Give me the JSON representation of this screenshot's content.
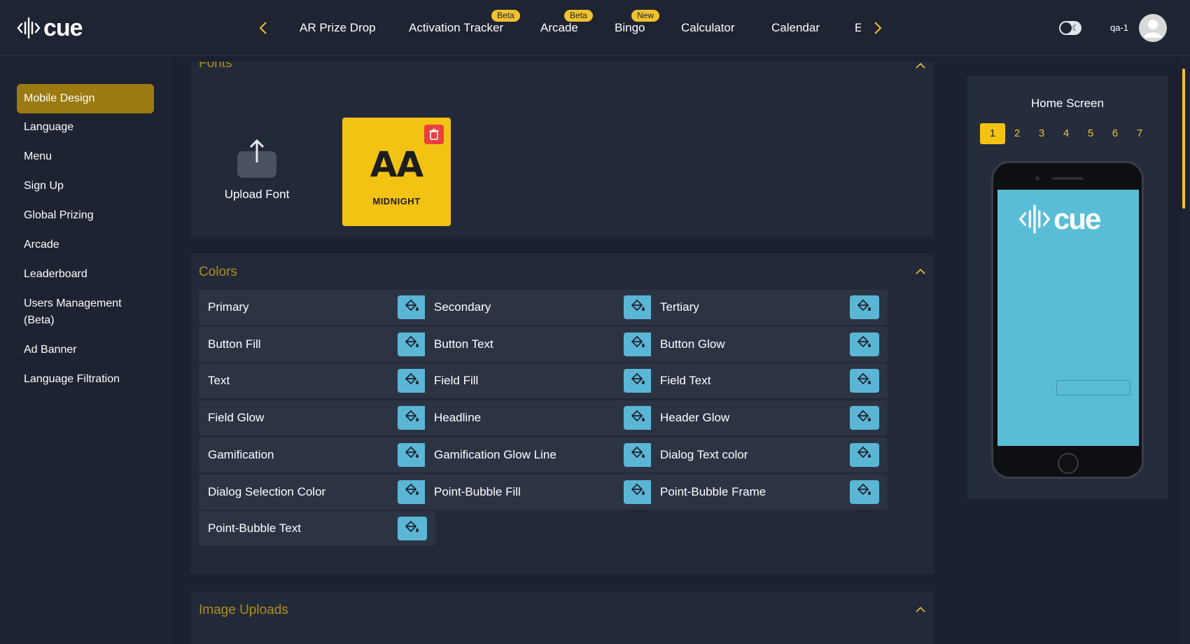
{
  "app": {
    "logo_text": "cue",
    "user_name": "qa-1"
  },
  "topnav": {
    "items": [
      {
        "label": "AR Prize Drop",
        "badge": ""
      },
      {
        "label": "Activation Tracker",
        "badge": "Beta"
      },
      {
        "label": "Arcade",
        "badge": "Beta"
      },
      {
        "label": "Bingo",
        "badge": "New"
      },
      {
        "label": "Calculator",
        "badge": ""
      },
      {
        "label": "Calendar",
        "badge": ""
      },
      {
        "label": "E",
        "badge": ""
      }
    ],
    "prev_icon": "chevron-left-icon",
    "next_icon": "chevron-right-icon"
  },
  "sidebar": {
    "items": [
      {
        "label": "Mobile Design",
        "active": true
      },
      {
        "label": "Language"
      },
      {
        "label": "Menu"
      },
      {
        "label": "Sign Up"
      },
      {
        "label": "Global Prizing"
      },
      {
        "label": "Arcade"
      },
      {
        "label": "Leaderboard"
      },
      {
        "label": "Users Management (Beta)"
      },
      {
        "label": "Ad Banner"
      },
      {
        "label": "Language Filtration"
      }
    ]
  },
  "fonts_section": {
    "title": "Fonts",
    "upload_label": "Upload Font",
    "font_card": {
      "preview": "AA",
      "name": "MIDNIGHT"
    }
  },
  "colors_section": {
    "title": "Colors",
    "items": [
      "Primary",
      "Secondary",
      "Tertiary",
      "Button Fill",
      "Button Text",
      "Button Glow",
      "Text",
      "Field Fill",
      "Field Text",
      "Field Glow",
      "Headline",
      "Header Glow",
      "Gamification",
      "Gamification Glow Line",
      "Dialog Text color",
      "Dialog Selection Color",
      "Point-Bubble Fill",
      "Point-Bubble Frame",
      "Point-Bubble Text"
    ],
    "picker_icon": "paint-bucket-icon",
    "picker_color": "#5bb6d5"
  },
  "image_uploads_section": {
    "title": "Image Uploads"
  },
  "preview": {
    "title": "Home Screen",
    "pages": [
      "1",
      "2",
      "3",
      "4",
      "5",
      "6",
      "7"
    ],
    "active_page": "1",
    "screen_color": "#5abdd8",
    "logo_text": "cue"
  },
  "colors": {
    "accent": "#f2c12e",
    "active_sidebar": "#9a7a11",
    "background": "#1d2330",
    "delete": "#ea3f3f"
  }
}
